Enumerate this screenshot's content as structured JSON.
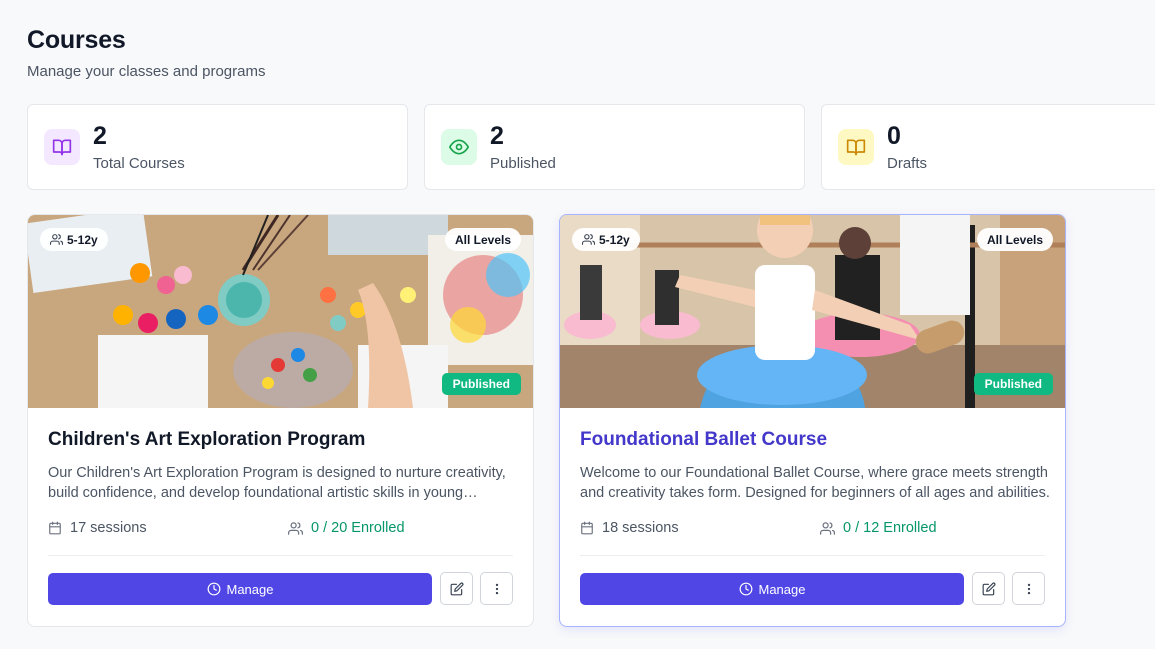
{
  "header": {
    "title": "Courses",
    "subtitle": "Manage your classes and programs"
  },
  "stats": [
    {
      "value": "2",
      "label": "Total Courses",
      "icon": "book-open-icon",
      "color": "#9333ea",
      "bg": "#f3e8ff"
    },
    {
      "value": "2",
      "label": "Published",
      "icon": "eye-icon",
      "color": "#16a34a",
      "bg": "#dcfce7"
    },
    {
      "value": "0",
      "label": "Drafts",
      "icon": "book-open-icon",
      "color": "#ca8a04",
      "bg": "#fef9c3"
    }
  ],
  "courses": [
    {
      "age": "5-12y",
      "level": "All Levels",
      "status": "Published",
      "title": "Children's Art Exploration Program",
      "description": "Our Children's Art Exploration Program is designed to nurture creativity, build confidence, and develop foundational artistic skills in young learners through hands-on projects.",
      "sessions": "17 sessions",
      "enrolled": "0 / 20 Enrolled",
      "manage_label": "Manage",
      "image": "art-supplies-photo"
    },
    {
      "age": "5-12y",
      "level": "All Levels",
      "status": "Published",
      "title": "Foundational Ballet Course",
      "description": "Welcome to our Foundational Ballet Course, where grace meets strength and creativity takes form. Designed for beginners of all ages and abilities.",
      "sessions": "18 sessions",
      "enrolled": "0 / 12 Enrolled",
      "manage_label": "Manage",
      "image": "ballet-class-photo"
    }
  ],
  "colors": {
    "primary": "#4f46e5",
    "success": "#10b981",
    "enrolled_text": "#059669"
  }
}
